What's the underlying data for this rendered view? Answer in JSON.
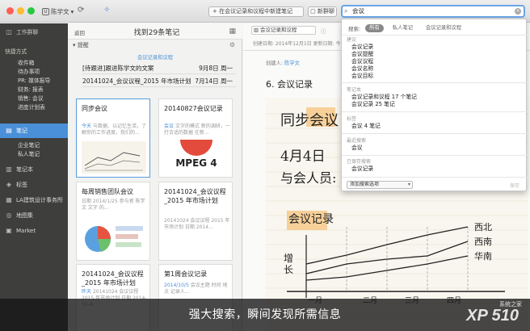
{
  "account": {
    "name": "陈学文"
  },
  "toolbar": {
    "new_note": "+ 在会议记录和议程中新建笔记",
    "new_chat": "新群聊",
    "search_value": "会议"
  },
  "sidebar": {
    "workchat": "工作群聊",
    "shortcuts_head": "快捷方式",
    "shortcuts": [
      "收件箱",
      "待办事项",
      "PR: 媒体报导",
      "财务: 报表",
      "销售: 会议",
      "进度计划表"
    ],
    "notes": "笔记",
    "note_subs": [
      "企业笔记",
      "私人笔记"
    ],
    "notebooks": "笔记本",
    "tags": "标签",
    "la": "LA建筑设计事务所",
    "atlas": "地图集",
    "market": "Market"
  },
  "list": {
    "back": "返回",
    "title": "找到29条笔记",
    "reminder_label": "提醒",
    "reminder_scope": "会议记录和议程",
    "reminders": [
      {
        "title": "[待跟进]跟进陈学文的文案",
        "date": "9月8日 周一"
      },
      {
        "title": "20141024_会议议程_2015 年市场计划",
        "date": "7月14日 周一"
      }
    ],
    "cards": [
      {
        "title": "同步会议",
        "snip_hl": "今天",
        "snip": "与数据、以记忆生活，了解你的工作进度，我们的..."
      },
      {
        "title": "20140827会议记录",
        "snip_hl": "会议",
        "snip": "文字的模式 新的调研，一打合适的数据 在新..."
      },
      {
        "title": "每周销售团队会议",
        "snip_hl": "",
        "snip": "日期 2014/1/25 参与者 陈学文 文字 的..."
      },
      {
        "title": "20141024_会议议程_2015 年市场计划",
        "snip_hl": "",
        "snip": "20141024 会议议程 2015 年市场计划 日期 2014..."
      },
      {
        "title": "20141024_会议议程_2015 年市场计划",
        "snip_hl": "昨天",
        "snip": "20141024 会议议程 2015 年市场计划 日期 2014-10-4..."
      },
      {
        "title": "第1周会议记录",
        "snip_hl": "2014/10/5",
        "snip": "会议主题 时间 地点 记录人..."
      }
    ],
    "mpeg_label": "MPEG 4"
  },
  "detail": {
    "notebook": "会议记录和议程",
    "meta": "创建日期: 2014年12月1日   更新日期: 今天",
    "creator_label": "创建人: ",
    "creator": "陈学文",
    "title": "6. 会议记录",
    "hand_title": "同步会议",
    "hand_date": "4月4日",
    "hand_who": "与会人员: 文",
    "hand_sub": "会议记录",
    "hand_ylabel": "增长",
    "hand_series": [
      "西北",
      "西南",
      "华南"
    ],
    "hand_x": [
      "一月",
      "二月",
      "三月",
      "四月"
    ]
  },
  "popup": {
    "scope_label": "搜索:",
    "scopes": [
      "所有",
      "私人笔记",
      "会议记录和议程"
    ],
    "suggest_head": "建议",
    "suggestions": [
      "会议记录",
      "会议提醒",
      "会议议程",
      "会议名称",
      "会议目标"
    ],
    "notebook_head": "笔记本",
    "notebooks": [
      "会议记录和议程 17 个笔记",
      "会议记录 25 笔记"
    ],
    "tag_head": "标签",
    "tags": [
      "会议 4 笔记"
    ],
    "recent_head": "最近搜索",
    "recent": [
      "会议"
    ],
    "saved_head": "已保存搜索",
    "saved": [
      "会议记录"
    ],
    "add_search": "添加搜索选项",
    "save": "保存"
  },
  "caption": "强大搜索，瞬间发现所需信息",
  "watermark": "XP 510",
  "watermark_sub": "系统之家",
  "colors": {
    "accent": "#4a90d9",
    "sidebar": "#3e3f3c",
    "selected": "#4a90d9"
  }
}
